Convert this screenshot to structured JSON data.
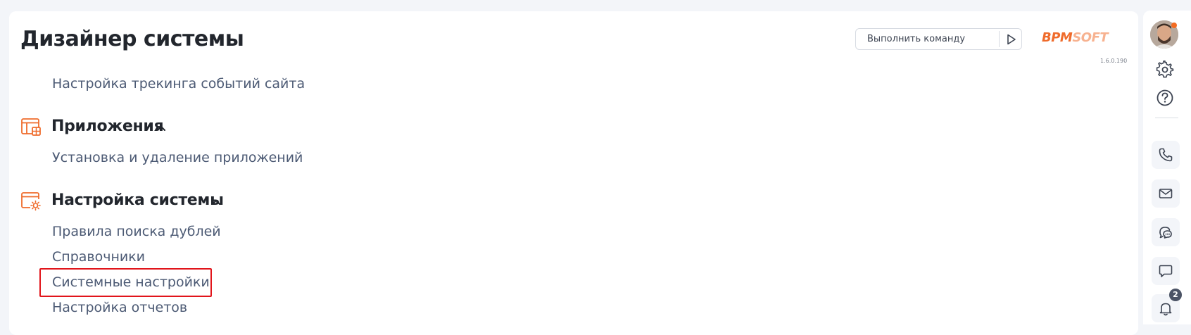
{
  "header": {
    "title": "Дизайнер системы",
    "command_placeholder": "Выполнить команду",
    "logo_bpm": "BPM",
    "logo_soft": "SOFT",
    "version": "1.6.0.190"
  },
  "content": {
    "top_item": "Настройка трекинга событий сайта",
    "sections": [
      {
        "title": "Приложения",
        "icon": "app-window-icon",
        "items": [
          "Установка и удаление приложений"
        ]
      },
      {
        "title": "Настройка системы",
        "icon": "system-settings-icon",
        "items": [
          "Правила поиска дублей",
          "Справочники",
          "Системные настройки",
          "Настройка отчетов"
        ]
      }
    ],
    "highlighted_item": "Системные настройки"
  },
  "right_rail": {
    "icons": [
      "avatar",
      "gear-icon",
      "help-icon",
      "phone-icon",
      "mail-icon",
      "chat-bubbles-icon",
      "comment-icon",
      "bell-icon"
    ],
    "notification_count": "2"
  },
  "colors": {
    "accent": "#ef6b2b",
    "highlight_border": "#e1151b",
    "menu_text": "#4c5a74",
    "title_text": "#22262d"
  }
}
